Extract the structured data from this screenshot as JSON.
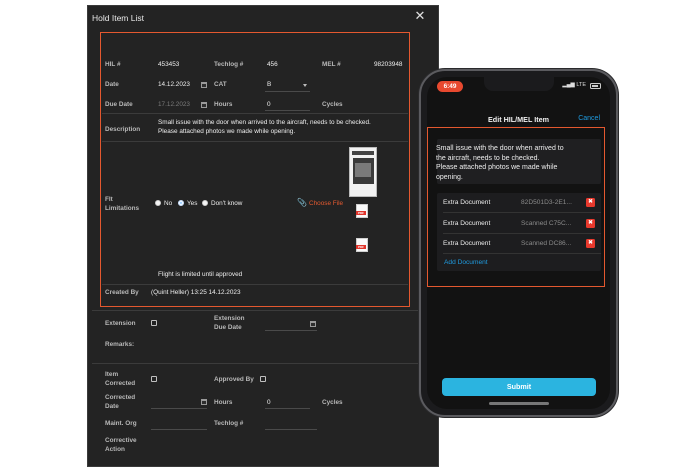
{
  "dialog": {
    "title": "Hold Item List",
    "close_icon": "close-icon",
    "fields": {
      "hil_label": "HIL #",
      "hil_value": "453453",
      "techlog_label": "Techlog #",
      "techlog_value": "456",
      "mel_label": "MEL #",
      "mel_value": "98203948",
      "date_label": "Date",
      "date_value": "14.12.2023",
      "cat_label": "CAT",
      "cat_value": "B",
      "due_date_label": "Due Date",
      "due_date_value": "17.12.2023",
      "hours_label": "Hours",
      "hours_value": "0",
      "cycles_label": "Cycles",
      "description_label": "Description",
      "description_line1": "Small issue with the door when arrived to the aircraft, needs to be checked.",
      "description_line2": "Please attached photos we made while opening.",
      "flt_label_1": "Flt",
      "flt_label_2": "Limitations",
      "radio_no": "No",
      "radio_yes": "Yes",
      "radio_dontknow": "Don't know",
      "choose_file": "Choose File",
      "pdf_tag": "PDF",
      "flight_limited": "Flight is limited until approved",
      "created_by_label": "Created By",
      "created_by_value": "(Quint Heller) 13:25 14.12.2023"
    },
    "extension": {
      "extension_label": "Extension",
      "ext_due_label_1": "Extension",
      "ext_due_label_2": "Due Date",
      "remarks_label": "Remarks:"
    },
    "correction": {
      "item_label_1": "Item",
      "item_label_2": "Corrected",
      "approved_by_label": "Approved By",
      "corrected_label_1": "Corrected",
      "corrected_label_2": "Date",
      "hours_label": "Hours",
      "hours_value": "0",
      "cycles_label": "Cycles",
      "maint_org_label": "Maint. Org",
      "techlog_label": "Techlog #",
      "corrective_label_1": "Corrective",
      "corrective_label_2": "Action"
    }
  },
  "phone": {
    "time": "6:49",
    "network": "LTE",
    "title": "Edit HIL/MEL Item",
    "cancel": "Cancel",
    "description": [
      "Small issue with the door when arrived to",
      "the aircraft, needs to be checked.",
      "Please attached photos we made while",
      "opening."
    ],
    "documents": [
      {
        "name": "Extra Document",
        "id": "82D501D3-2E1..."
      },
      {
        "name": "Extra Document",
        "id": "Scanned C75C..."
      },
      {
        "name": "Extra Document",
        "id": "Scanned DC86..."
      }
    ],
    "add_document": "Add Document",
    "submit": "Submit"
  },
  "colors": {
    "highlight": "#e4582f",
    "accent_blue": "#1f9be0",
    "submit": "#2bb4e0",
    "delete": "#e8392d"
  }
}
